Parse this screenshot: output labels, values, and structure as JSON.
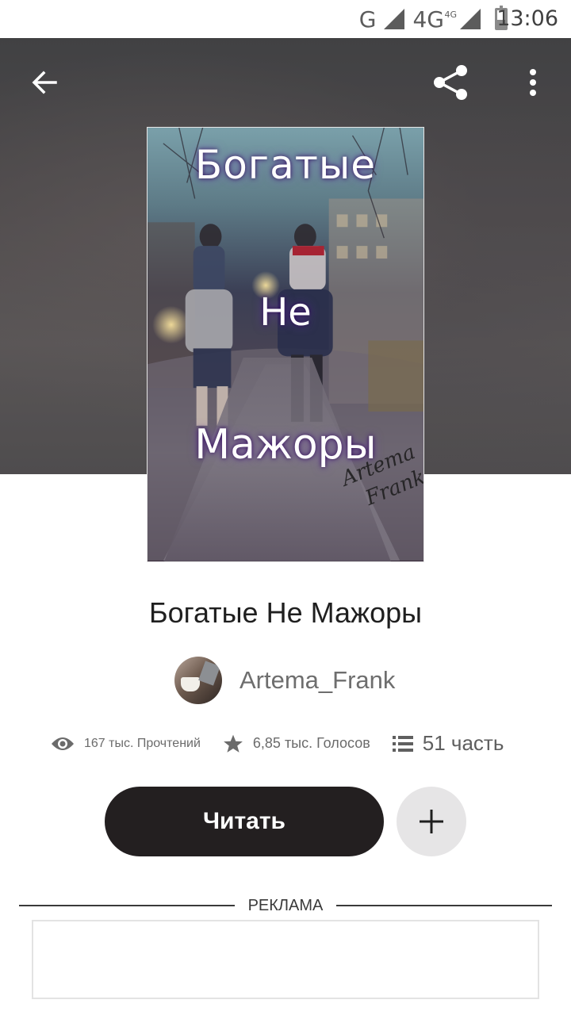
{
  "status_bar": {
    "network_g": "G",
    "network_4g": "4G",
    "network_4g_small": "4G",
    "battery_level": 0.45,
    "time": "13:06"
  },
  "toolbar": {
    "back_icon": "arrow-left-icon",
    "share_icon": "share-icon",
    "menu_icon": "more-vertical-icon"
  },
  "cover": {
    "line1": "Богатые",
    "line2": "Не",
    "line3": "Мажоры",
    "signature_line1": "Artema",
    "signature_line2": "Frank"
  },
  "story": {
    "title": "Богатые Не Мажоры",
    "author": "Artema_Frank"
  },
  "stats": {
    "reads": "167 тыс. Прочтений",
    "votes": "6,85 тыс. Голосов",
    "parts": "51 часть"
  },
  "actions": {
    "read_label": "Читать",
    "add_icon": "plus-icon"
  },
  "ad": {
    "label": "РЕКЛАМА"
  },
  "colors": {
    "primary_button": "#231f20",
    "secondary_button": "#e6e5e6"
  }
}
